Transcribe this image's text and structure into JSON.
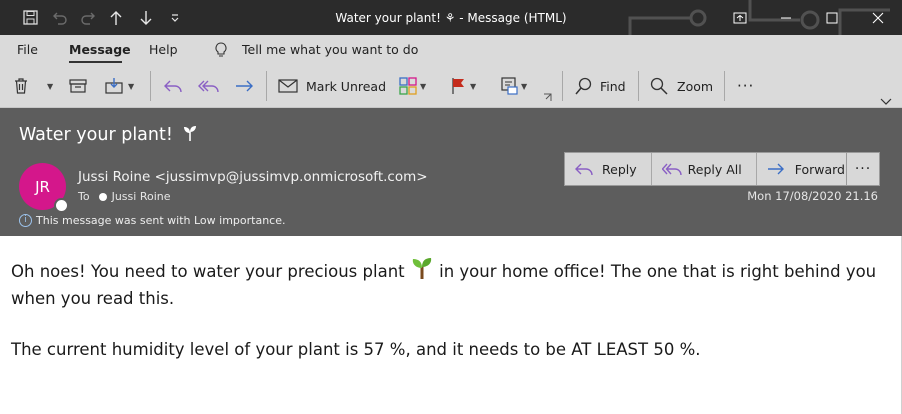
{
  "window": {
    "title": "Water your plant! ⚘  -  Message (HTML)",
    "titlebar_bg": "#2b2b2b"
  },
  "menu": {
    "file": "File",
    "message": "Message",
    "help": "Help",
    "tell_me": "Tell me what you want to do"
  },
  "ribbon": {
    "mark_unread": "Mark Unread",
    "find": "Find",
    "zoom": "Zoom",
    "more": "···"
  },
  "email": {
    "subject": "Water your plant!",
    "avatar_initials": "JR",
    "avatar_color": "#d4178b",
    "sender": "Jussi Roine <jussimvp@jussimvp.onmicrosoft.com>",
    "to_label": "To",
    "to_name": "Jussi Roine",
    "importance_note": "This message was sent with Low importance.",
    "date": "Mon 17/08/2020 21.16",
    "actions": {
      "reply": "Reply",
      "reply_all": "Reply All",
      "forward": "Forward",
      "more": "···"
    },
    "body": {
      "line1_before": "Oh noes! You need to water your precious plant ",
      "line1_after": " in your home office! The one that is right behind you when you read this.",
      "line2": "The current humidity level of your plant is 57 %, and it needs to be AT LEAST 50 %."
    }
  },
  "colors": {
    "accent_purple": "#8a5fc4",
    "accent_blue": "#3b6ec5",
    "header_bg": "#5d5d5d"
  }
}
